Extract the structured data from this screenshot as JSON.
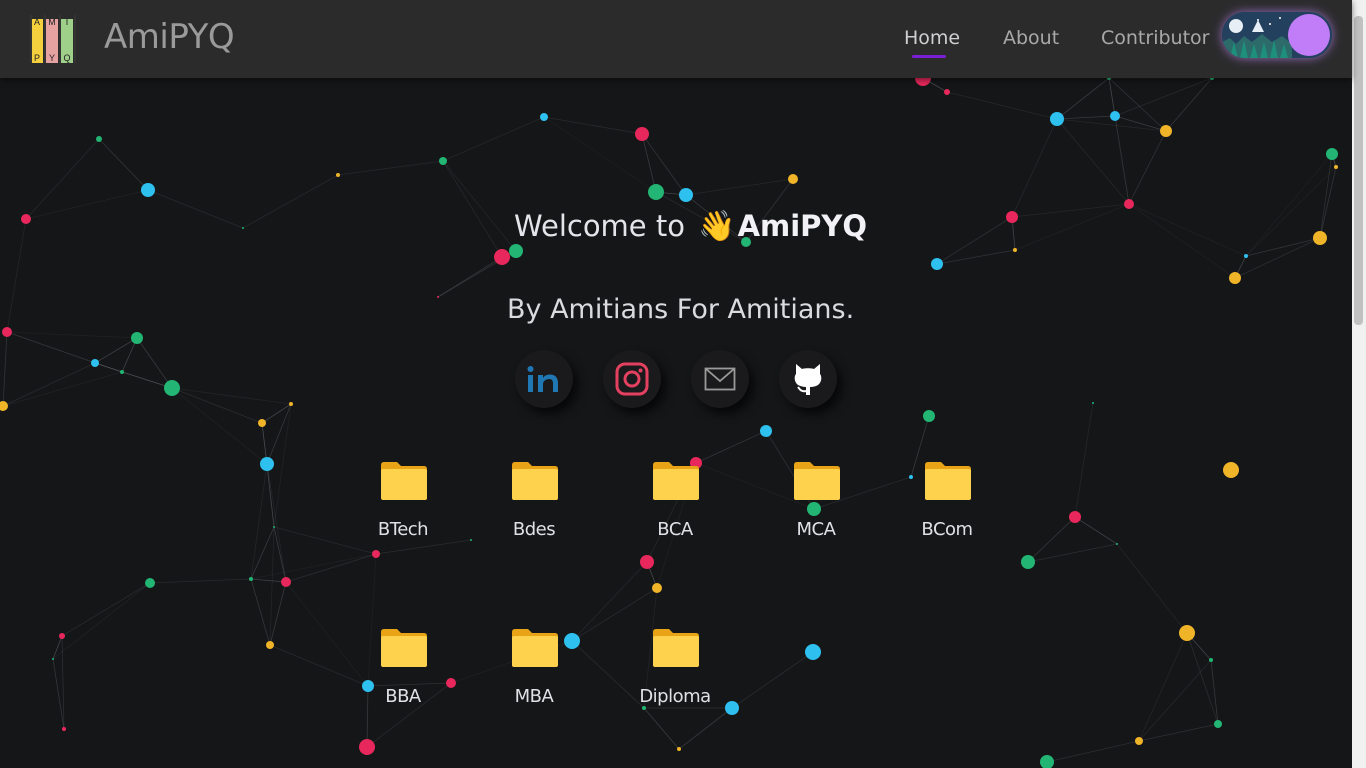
{
  "header": {
    "brand": "AmiPYQ",
    "logo_letters": [
      "A",
      "M",
      "I",
      "P",
      "Y",
      "Q"
    ],
    "nav": [
      {
        "label": "Home",
        "active": true
      },
      {
        "label": "About",
        "active": false
      },
      {
        "label": "Contributor",
        "active": false
      }
    ],
    "theme_toggle": {
      "state": "dark"
    }
  },
  "hero": {
    "welcome_prefix": "Welcome to",
    "wave_emoji": "👋",
    "welcome_brand": "AmiPYQ",
    "tagline": "By Amitians For Amitians."
  },
  "social": [
    {
      "icon": "linkedin-icon",
      "color": "#1f78b4"
    },
    {
      "icon": "instagram-icon",
      "color": "#e4405f"
    },
    {
      "icon": "mail-icon",
      "color": "#9a9a9a"
    },
    {
      "icon": "github-icon",
      "color": "#ffffff"
    }
  ],
  "courses": [
    {
      "label": "BTech"
    },
    {
      "label": "Bdes"
    },
    {
      "label": "BCA"
    },
    {
      "label": "MCA"
    },
    {
      "label": "BCom"
    },
    {
      "label": "BBA"
    },
    {
      "label": "MBA"
    },
    {
      "label": "Diploma"
    }
  ],
  "colors": {
    "accent": "#7b1fd6",
    "folder": "#ffd24d",
    "dot_red": "#e8285c",
    "dot_blue": "#2ec0ee",
    "dot_green": "#22b573",
    "dot_yellow": "#f0b429"
  }
}
